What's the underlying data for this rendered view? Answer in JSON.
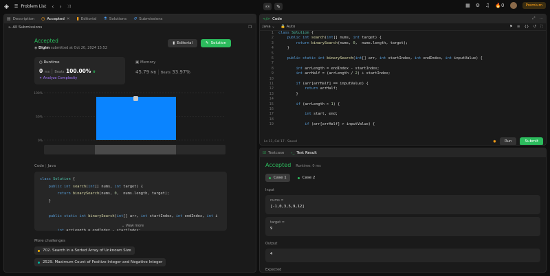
{
  "topbar": {
    "title": "Problem List",
    "premium": "Premium",
    "streak": "0"
  },
  "left_tabs": [
    {
      "label": "Description"
    },
    {
      "label": "Accepted"
    },
    {
      "label": "Editorial"
    },
    {
      "label": "Solutions"
    },
    {
      "label": "Submissions"
    }
  ],
  "left": {
    "all_submissions": "All Submissions",
    "status": "Accepted",
    "user": "Digim",
    "submitted_at": "submitted at Oct 20, 2024 15:52",
    "editorial_btn": "Editorial",
    "solution_btn": "Solution",
    "runtime": {
      "label": "Runtime",
      "value": "0",
      "unit": "ms",
      "beats_label": "Beats",
      "beats": "100.00%",
      "analyze": "Analyze Complexity"
    },
    "memory": {
      "label": "Memory",
      "value": "45.79",
      "unit": "MB",
      "beats_label": "Beats",
      "beats": "33.97%"
    },
    "chart_data": {
      "type": "bar",
      "yticks": [
        "100%",
        "50%",
        "0%"
      ],
      "values": [
        100
      ],
      "bar_color": "#0a84ff"
    },
    "code_label": "Code",
    "code_lang": "Java",
    "code_preview": [
      "class Solution {",
      "    public int search(int[] nums, int target) {",
      "        return binarySearch(nums, 0,  nums.length, target);",
      "    }",
      "",
      "    public static int binarySearch(int[] arr, int startIndex, int endIndex, int i",
      "",
      "        int arrLength = endIndex - startIndex;"
    ],
    "view_more": "View more",
    "more_challenges": "More challenges",
    "challenges": [
      {
        "label": "702. Search in a Sorted Array of Unknown Size",
        "color": "#ffb800"
      },
      {
        "label": "2529. Maximum Count of Positive Integer and Negative Integer",
        "color": "#00b8a3"
      }
    ]
  },
  "editor": {
    "title": "Code",
    "lang": "Java",
    "auto": "Auto",
    "lines": [
      "class Solution {",
      "    public int search(int[] nums, int target) {",
      "        return binarySearch(nums, 0,  nums.length, target);",
      "    }",
      "",
      "    public static int binarySearch(int[] arr, int startIndex, int endIndex, int inputValue) {",
      "",
      "        int arrLength = endIndex - startIndex;",
      "        int arrHalf = (arrLength / 2) + startIndex;",
      "",
      "        if (arr[arrHalf] == inputValue) {",
      "            return arrHalf;",
      "        }",
      "",
      "        if (arrLength > 1) {",
      "",
      "            int start, end;",
      "",
      "            if (arr[arrHalf] > inputValue) {"
    ],
    "status": "Ln 11, Col 17  ·  Saved",
    "run": "Run",
    "submit": "Submit"
  },
  "result": {
    "tab_testcase": "Testcase",
    "tab_result": "Test Result",
    "status": "Accepted",
    "runtime": "Runtime: 0 ms",
    "cases": [
      "Case 1",
      "Case 2"
    ],
    "input_label": "Input",
    "nums_label": "nums =",
    "nums_value": "[-1,0,3,5,9,12]",
    "target_label": "target =",
    "target_value": "9",
    "output_label": "Output",
    "output_value": "4",
    "expected_label": "Expected"
  }
}
